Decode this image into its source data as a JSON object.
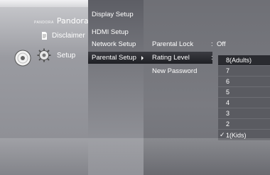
{
  "brand": {
    "small": "PANDORA",
    "name": "Pandora"
  },
  "left_menu": {
    "disclaimer": "Disclaimer",
    "setup": "Setup"
  },
  "setup_menu": {
    "items": [
      "Display Setup",
      "HDMI Setup",
      "Network Setup",
      "Parental Setup"
    ],
    "selected": "Parental Setup"
  },
  "parental_menu": {
    "items": [
      {
        "label": "Parental Lock",
        "value": "Off"
      },
      {
        "label": "Rating Level",
        "value": ""
      },
      {
        "label": "New Password",
        "value": ""
      }
    ],
    "selected": "Rating Level",
    "colon": ":"
  },
  "rating_dropdown": {
    "options": [
      "8(Adults)",
      "7",
      "6",
      "5",
      "4",
      "3",
      "2",
      "1(Kids)"
    ],
    "highlighted": "8(Adults)",
    "checked": "1(Kids)"
  },
  "icons": {
    "disclaimer": "document-icon",
    "setup": "gear-icon",
    "dvd": "dvd-disc-icon",
    "arrow": "triangle-right-icon",
    "check": "check-icon"
  }
}
